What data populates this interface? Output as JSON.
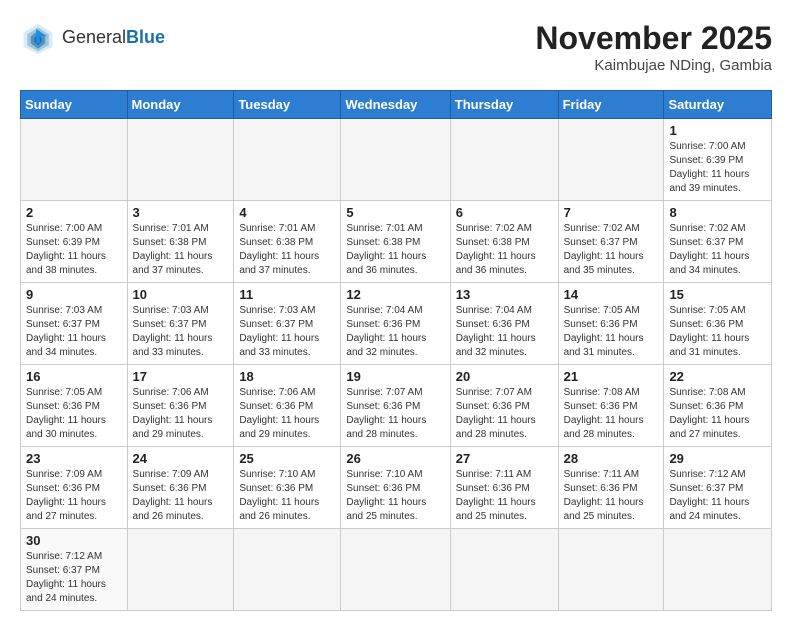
{
  "header": {
    "logo_general": "General",
    "logo_blue": "Blue",
    "month_year": "November 2025",
    "location": "Kaimbujae NDing, Gambia"
  },
  "weekdays": [
    "Sunday",
    "Monday",
    "Tuesday",
    "Wednesday",
    "Thursday",
    "Friday",
    "Saturday"
  ],
  "weeks": [
    [
      {
        "day": "",
        "info": ""
      },
      {
        "day": "",
        "info": ""
      },
      {
        "day": "",
        "info": ""
      },
      {
        "day": "",
        "info": ""
      },
      {
        "day": "",
        "info": ""
      },
      {
        "day": "",
        "info": ""
      },
      {
        "day": "1",
        "info": "Sunrise: 7:00 AM\nSunset: 6:39 PM\nDaylight: 11 hours and 39 minutes."
      }
    ],
    [
      {
        "day": "2",
        "info": "Sunrise: 7:00 AM\nSunset: 6:39 PM\nDaylight: 11 hours and 38 minutes."
      },
      {
        "day": "3",
        "info": "Sunrise: 7:01 AM\nSunset: 6:38 PM\nDaylight: 11 hours and 37 minutes."
      },
      {
        "day": "4",
        "info": "Sunrise: 7:01 AM\nSunset: 6:38 PM\nDaylight: 11 hours and 37 minutes."
      },
      {
        "day": "5",
        "info": "Sunrise: 7:01 AM\nSunset: 6:38 PM\nDaylight: 11 hours and 36 minutes."
      },
      {
        "day": "6",
        "info": "Sunrise: 7:02 AM\nSunset: 6:38 PM\nDaylight: 11 hours and 36 minutes."
      },
      {
        "day": "7",
        "info": "Sunrise: 7:02 AM\nSunset: 6:37 PM\nDaylight: 11 hours and 35 minutes."
      },
      {
        "day": "8",
        "info": "Sunrise: 7:02 AM\nSunset: 6:37 PM\nDaylight: 11 hours and 34 minutes."
      }
    ],
    [
      {
        "day": "9",
        "info": "Sunrise: 7:03 AM\nSunset: 6:37 PM\nDaylight: 11 hours and 34 minutes."
      },
      {
        "day": "10",
        "info": "Sunrise: 7:03 AM\nSunset: 6:37 PM\nDaylight: 11 hours and 33 minutes."
      },
      {
        "day": "11",
        "info": "Sunrise: 7:03 AM\nSunset: 6:37 PM\nDaylight: 11 hours and 33 minutes."
      },
      {
        "day": "12",
        "info": "Sunrise: 7:04 AM\nSunset: 6:36 PM\nDaylight: 11 hours and 32 minutes."
      },
      {
        "day": "13",
        "info": "Sunrise: 7:04 AM\nSunset: 6:36 PM\nDaylight: 11 hours and 32 minutes."
      },
      {
        "day": "14",
        "info": "Sunrise: 7:05 AM\nSunset: 6:36 PM\nDaylight: 11 hours and 31 minutes."
      },
      {
        "day": "15",
        "info": "Sunrise: 7:05 AM\nSunset: 6:36 PM\nDaylight: 11 hours and 31 minutes."
      }
    ],
    [
      {
        "day": "16",
        "info": "Sunrise: 7:05 AM\nSunset: 6:36 PM\nDaylight: 11 hours and 30 minutes."
      },
      {
        "day": "17",
        "info": "Sunrise: 7:06 AM\nSunset: 6:36 PM\nDaylight: 11 hours and 29 minutes."
      },
      {
        "day": "18",
        "info": "Sunrise: 7:06 AM\nSunset: 6:36 PM\nDaylight: 11 hours and 29 minutes."
      },
      {
        "day": "19",
        "info": "Sunrise: 7:07 AM\nSunset: 6:36 PM\nDaylight: 11 hours and 28 minutes."
      },
      {
        "day": "20",
        "info": "Sunrise: 7:07 AM\nSunset: 6:36 PM\nDaylight: 11 hours and 28 minutes."
      },
      {
        "day": "21",
        "info": "Sunrise: 7:08 AM\nSunset: 6:36 PM\nDaylight: 11 hours and 28 minutes."
      },
      {
        "day": "22",
        "info": "Sunrise: 7:08 AM\nSunset: 6:36 PM\nDaylight: 11 hours and 27 minutes."
      }
    ],
    [
      {
        "day": "23",
        "info": "Sunrise: 7:09 AM\nSunset: 6:36 PM\nDaylight: 11 hours and 27 minutes."
      },
      {
        "day": "24",
        "info": "Sunrise: 7:09 AM\nSunset: 6:36 PM\nDaylight: 11 hours and 26 minutes."
      },
      {
        "day": "25",
        "info": "Sunrise: 7:10 AM\nSunset: 6:36 PM\nDaylight: 11 hours and 26 minutes."
      },
      {
        "day": "26",
        "info": "Sunrise: 7:10 AM\nSunset: 6:36 PM\nDaylight: 11 hours and 25 minutes."
      },
      {
        "day": "27",
        "info": "Sunrise: 7:11 AM\nSunset: 6:36 PM\nDaylight: 11 hours and 25 minutes."
      },
      {
        "day": "28",
        "info": "Sunrise: 7:11 AM\nSunset: 6:36 PM\nDaylight: 11 hours and 25 minutes."
      },
      {
        "day": "29",
        "info": "Sunrise: 7:12 AM\nSunset: 6:37 PM\nDaylight: 11 hours and 24 minutes."
      }
    ],
    [
      {
        "day": "30",
        "info": "Sunrise: 7:12 AM\nSunset: 6:37 PM\nDaylight: 11 hours and 24 minutes."
      },
      {
        "day": "",
        "info": ""
      },
      {
        "day": "",
        "info": ""
      },
      {
        "day": "",
        "info": ""
      },
      {
        "day": "",
        "info": ""
      },
      {
        "day": "",
        "info": ""
      },
      {
        "day": "",
        "info": ""
      }
    ]
  ]
}
